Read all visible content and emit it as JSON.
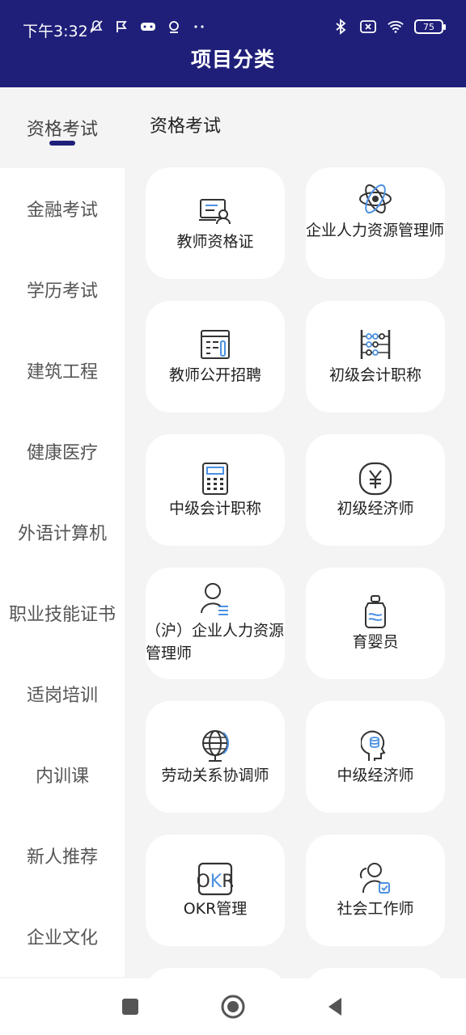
{
  "status_bar": {
    "time": "下午3:32",
    "left_icons": [
      "mute-icon",
      "flag-icon",
      "game-icon",
      "tag-icon",
      "more-dots-icon"
    ],
    "right_icons": [
      "bluetooth-icon",
      "sim-off-icon",
      "wifi-icon"
    ],
    "battery": "75"
  },
  "header": {
    "title": "项目分类"
  },
  "sidebar": {
    "items": [
      {
        "label": "资格考试",
        "active": true
      },
      {
        "label": "金融考试"
      },
      {
        "label": "学历考试"
      },
      {
        "label": "建筑工程"
      },
      {
        "label": "健康医疗"
      },
      {
        "label": "外语计算机"
      },
      {
        "label": "职业技能证书"
      },
      {
        "label": "适岗培训"
      },
      {
        "label": "内训课"
      },
      {
        "label": "新人推荐"
      },
      {
        "label": "企业文化"
      }
    ]
  },
  "content": {
    "section_title": "资格考试",
    "cards": [
      {
        "label": "教师资格证",
        "icon": "teacher-certificate-icon"
      },
      {
        "label": "企业人力资源管理师",
        "icon": "atom-icon"
      },
      {
        "label": "教师公开招聘",
        "icon": "recruitment-form-icon"
      },
      {
        "label": "初级会计职称",
        "icon": "abacus-icon"
      },
      {
        "label": "中级会计职称",
        "icon": "calculator-icon"
      },
      {
        "label": "初级经济师",
        "icon": "yuan-coin-icon"
      },
      {
        "label": "（沪）企业人力资源管理师",
        "icon": "person-list-icon"
      },
      {
        "label": "育婴员",
        "icon": "baby-bottle-icon"
      },
      {
        "label": "劳动关系协调师",
        "icon": "globe-icon"
      },
      {
        "label": "中级经济师",
        "icon": "head-coin-icon"
      },
      {
        "label": "OKR管理",
        "icon": "okr-icon"
      },
      {
        "label": "社会工作师",
        "icon": "social-worker-icon"
      }
    ]
  },
  "nav_bar": {
    "buttons": [
      "recent-apps-icon",
      "home-icon",
      "back-icon"
    ]
  }
}
